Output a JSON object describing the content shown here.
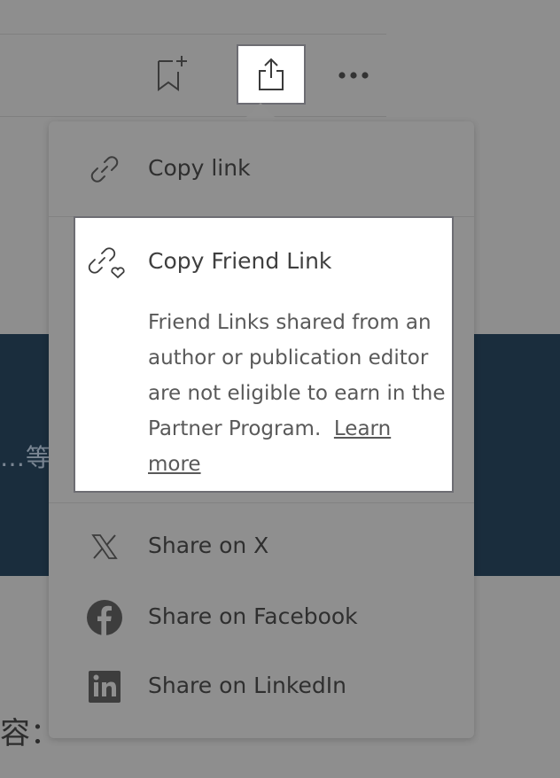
{
  "toolbar": {
    "bookmark_icon": "bookmark-add-icon",
    "share_icon": "share-icon",
    "more_icon": "more-horizontal-icon"
  },
  "background": {
    "banner_text": "…等",
    "body_fragment": "容："
  },
  "share_menu": {
    "copy_link_label": "Copy link",
    "friend_link": {
      "title": "Copy Friend Link",
      "description": "Friend Links shared from an author or publication editor are not eligible to earn in the Partner Program.",
      "learn_more": "Learn more"
    },
    "share_x_label": "Share on X",
    "share_facebook_label": "Share on Facebook",
    "share_linkedin_label": "Share on LinkedIn"
  },
  "colors": {
    "overlay": "#8e8e8e",
    "banner": "#1a2d3d",
    "card": "#ffffff",
    "focus_border": "#6d6d73"
  }
}
